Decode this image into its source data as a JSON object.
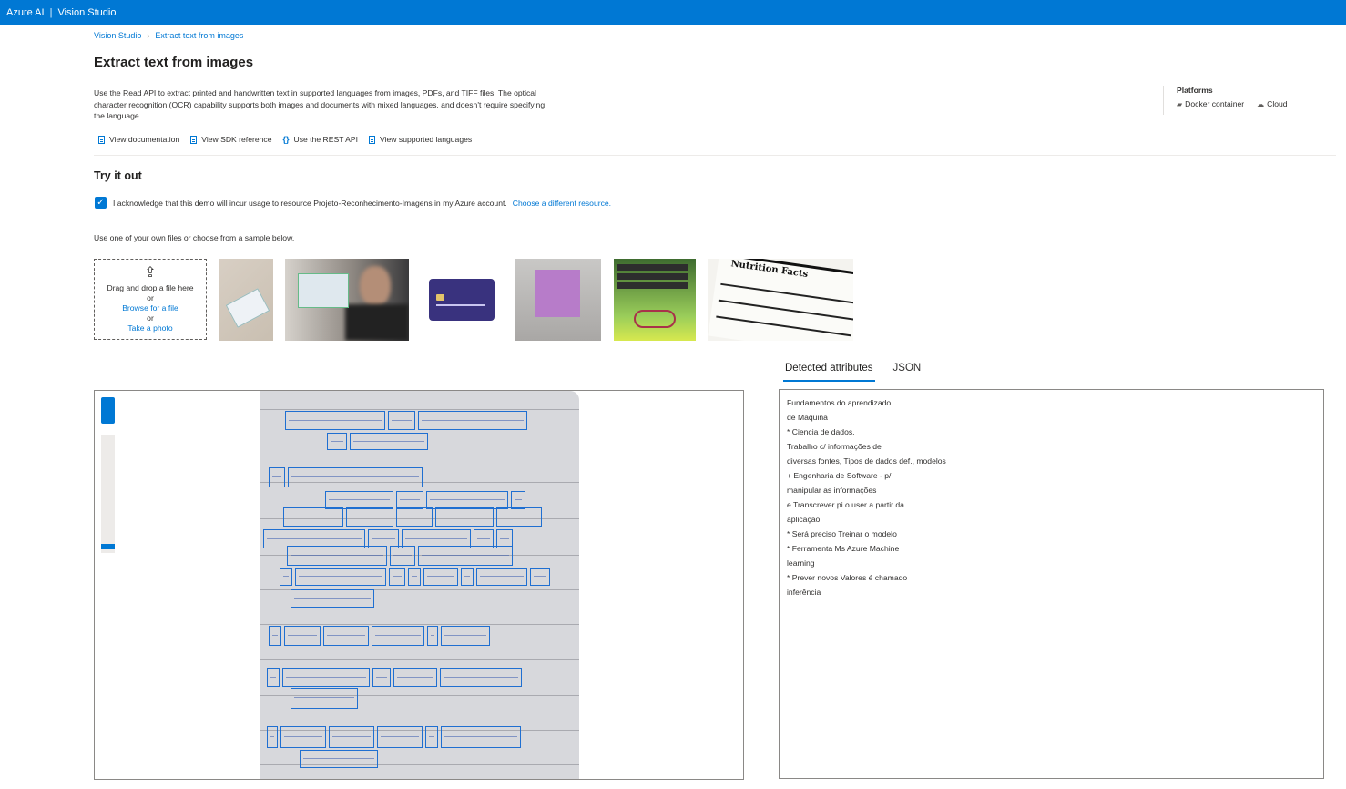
{
  "app": {
    "brand": "Azure AI",
    "separator": "|",
    "product": "Vision Studio"
  },
  "breadcrumb": {
    "home": "Vision Studio",
    "current": "Extract text from images"
  },
  "page": {
    "title": "Extract text from images",
    "description": "Use the Read API to extract printed and handwritten text in supported languages from images, PDFs, and TIFF files. The optical character recognition (OCR) capability supports both images and documents with mixed languages, and doesn't require specifying the language."
  },
  "platforms": {
    "title": "Platforms",
    "items": [
      "Docker container",
      "Cloud"
    ]
  },
  "links": [
    "View documentation",
    "View SDK reference",
    "Use the REST API",
    "View supported languages"
  ],
  "try_it": {
    "title": "Try it out",
    "acknowledge": "I acknowledge that this demo will incur usage to resource Projeto-Reconhecimento-Imagens in my Azure account.",
    "choose_resource": "Choose a different resource.",
    "checked": true,
    "instructions": "Use one of your own files or choose from a sample below."
  },
  "upload": {
    "drag": "Drag and drop a file here",
    "or1": "or",
    "browse": "Browse for a file",
    "or2": "or",
    "photo": "Take a photo"
  },
  "samples": [
    {
      "icon": "social-security-card-image"
    },
    {
      "icon": "man-holding-id-card-image"
    },
    {
      "icon": "credit-card-image"
    },
    {
      "icon": "sticky-note-image"
    },
    {
      "icon": "life-is-like-riding-a-bicycle-poster-image"
    },
    {
      "icon": "nutrition-facts-label-image",
      "heading": "Nutrition Facts"
    }
  ],
  "result_tabs": [
    {
      "label": "Detected attributes",
      "active": true
    },
    {
      "label": "JSON",
      "active": false
    }
  ],
  "detected_text": [
    "Fundamentos do aprendizado",
    "de Maquina",
    "* Ciencia de dados.",
    "Trabalho c/ informações de",
    "diversas fontes, Tipos de dados def., modelos",
    "+ Engenharia de Software - p/",
    "manipular as informações",
    "e Transcrever pi o user a partir da",
    "aplicação.",
    "* Será preciso Treinar o modelo",
    "* Ferramenta Ms Azure Machine",
    "learning",
    "* Prever novos Valores é chamado",
    "inferência"
  ],
  "colors": {
    "accent": "#0078d4",
    "ocr_box": "#1f6fd1",
    "paper": "#d7d8dc"
  }
}
